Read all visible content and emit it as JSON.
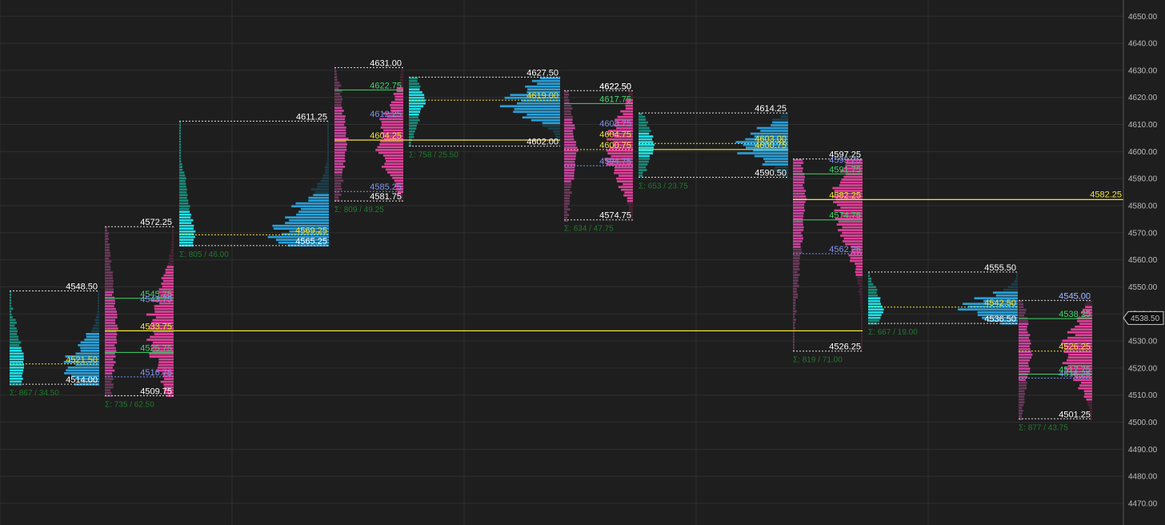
{
  "chart_data": {
    "type": "volume_profile",
    "y_axis": {
      "ylim": [
        4462,
        4656
      ],
      "ticks": [
        "4470.00",
        "4480.00",
        "4490.00",
        "4500.00",
        "4510.00",
        "4520.00",
        "4530.00",
        "4540.00",
        "4550.00",
        "4560.00",
        "4570.00",
        "4580.00",
        "4590.00",
        "4600.00",
        "4610.00",
        "4620.00",
        "4630.00",
        "4640.00",
        "4650.00"
      ],
      "current_price": "4538.50"
    },
    "profiles": [
      {
        "id": 1,
        "high": "4548.50",
        "low": "4514.00",
        "poc": "4521.50",
        "vah": "",
        "val": "",
        "summary": "Σ: 867 / 34.50",
        "kind": "tpo-cyan"
      },
      {
        "id": 2,
        "high": "4572.25",
        "low": "4509.75",
        "poc": "4533.75",
        "vah": "4545.75",
        "vah2": "4543.75",
        "val": "4516.75",
        "mid": "4525.75",
        "summary": "Σ: 735 / 62.50",
        "kind": "pink"
      },
      {
        "id": 3,
        "high": "4611.25",
        "low": "4565.25",
        "poc": "4569.25",
        "vah": "",
        "val": "",
        "summary": "Σ: 805 / 46.00",
        "kind": "tpo-cyan"
      },
      {
        "id": 4,
        "high": "4631.00",
        "low": "4581.75",
        "poc": "4604.25",
        "vah": "4622.75",
        "vah2": "4612.25",
        "val": "4585.25",
        "summary": "Σ: 809 / 49.25",
        "kind": "pink"
      },
      {
        "id": 5,
        "high": "4627.50",
        "low": "4602.00",
        "poc": "4619.00",
        "vah": "",
        "val": "",
        "summary": "Σ: 758 / 25.50",
        "kind": "tpo-cyan"
      },
      {
        "id": 6,
        "high": "4622.50",
        "low": "4574.75",
        "poc": "4600.75",
        "vah": "4617.75",
        "vah2": "4608.75",
        "val": "4594.75",
        "extra": "4604.75",
        "extra2": "4622.50",
        "summary": "Σ: 634 / 47.75",
        "kind": "pink"
      },
      {
        "id": 7,
        "high": "4614.25",
        "low": "4590.50",
        "poc": "4603.00",
        "vah": "",
        "val": "",
        "extra": "4600.75",
        "summary": "Σ: 653 / 23.75",
        "kind": "tpo-cyan"
      },
      {
        "id": 8,
        "high": "4597.25",
        "low": "4526.25",
        "poc": "4582.25",
        "vah": "4591.75",
        "vah2": "4595.25",
        "val": "4562.25",
        "mid": "4574.75",
        "poc_extend": "4582.25",
        "prev_poc": "4533.75",
        "summary": "Σ: 819 / 71.00",
        "kind": "pink"
      },
      {
        "id": 9,
        "high": "4555.50",
        "low": "4536.50",
        "poc": "4542.50",
        "vah": "",
        "val": "",
        "summary": "Σ: 667 / 19.00",
        "kind": "tpo-cyan"
      },
      {
        "id": 10,
        "high": "4545.00",
        "low": "4501.25",
        "poc": "4526.25",
        "vah": "4538.25",
        "vah2": "4545.00",
        "val": "4516.25",
        "mid": "4517.75",
        "summary": "Σ: 877 / 43.75",
        "kind": "pink"
      }
    ],
    "naked_poc": "4582.25",
    "long_poc": "4533.75"
  },
  "colors": {
    "background": "#1e1e1e",
    "grid": "#2e2e2e",
    "cyan": "#1ee0e8",
    "blue": "#2a9fd6",
    "pink": "#e0409a",
    "magenta": "#c9449e",
    "poc": "#f2e23a",
    "vah": "#3ed46a",
    "val": "#7f93f0",
    "text": "#ffffff",
    "summary": "#1f7a2e"
  }
}
